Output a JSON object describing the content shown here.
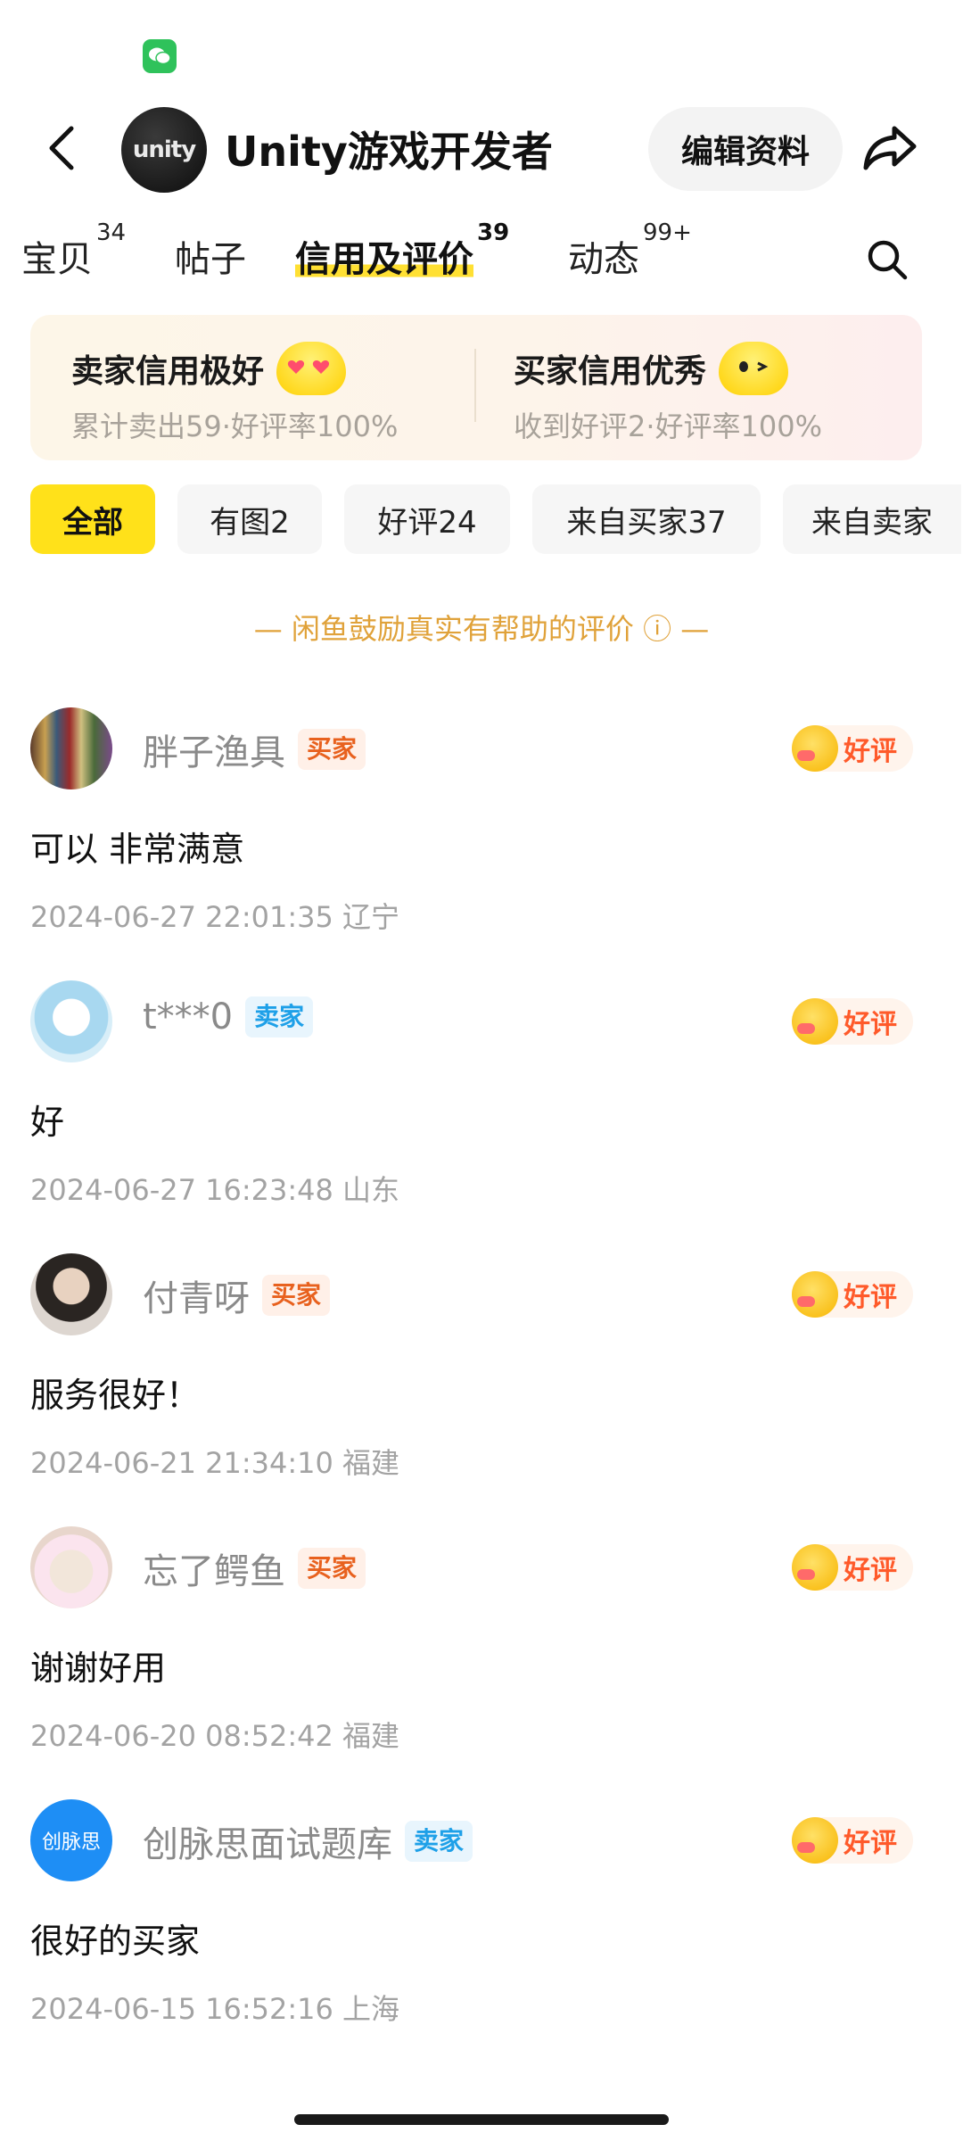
{
  "header": {
    "avatar_text": "unity",
    "title": "Unity游戏开发者",
    "edit_label": "编辑资料"
  },
  "tabs": [
    {
      "label": "宝贝",
      "count": "34"
    },
    {
      "label": "帖子",
      "count": ""
    },
    {
      "label": "信用及评价",
      "count": "39"
    },
    {
      "label": "动态",
      "count": "99+"
    }
  ],
  "credit": {
    "seller": {
      "title": "卖家信用极好",
      "sub": "累计卖出59·好评率100%"
    },
    "buyer": {
      "title": "买家信用优秀",
      "sub": "收到好评2·好评率100%"
    }
  },
  "filters": [
    {
      "label": "全部"
    },
    {
      "label": "有图2"
    },
    {
      "label": "好评24"
    },
    {
      "label": "来自买家37"
    },
    {
      "label": "来自卖家"
    }
  ],
  "notice": "— 闲鱼鼓励真实有帮助的评价 ⓘ —",
  "reviews": [
    {
      "name": "胖子渔具",
      "role": "买家",
      "rating": "好评",
      "text": "可以 非常满意",
      "meta": "2024-06-27 22:01:35 辽宁"
    },
    {
      "name": "t***0",
      "role": "卖家",
      "rating": "好评",
      "text": "好",
      "meta": "2024-06-27 16:23:48 山东"
    },
    {
      "name": "付青呀",
      "role": "买家",
      "rating": "好评",
      "text": "服务很好！",
      "meta": "2024-06-21 21:34:10 福建"
    },
    {
      "name": "忘了鳄鱼",
      "role": "买家",
      "rating": "好评",
      "text": "谢谢好用",
      "meta": "2024-06-20 08:52:42 福建"
    },
    {
      "name": "创脉思面试题库",
      "role": "卖家",
      "rating": "好评",
      "text": "很好的买家",
      "meta": "2024-06-15 16:52:16 上海",
      "avatar_text": "创脉思"
    }
  ],
  "colors": {
    "accent_yellow": "#ffe11a",
    "buyer_badge": "#e8611e",
    "seller_badge": "#1ea0e8",
    "rating_text": "#ff5a2a",
    "notice": "#e0a23a"
  }
}
